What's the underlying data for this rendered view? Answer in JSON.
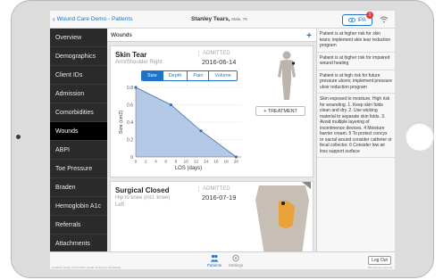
{
  "header": {
    "back_label": "Wound Care Demo - Patients",
    "patient_name": "Stanley Tears",
    "patient_meta": "Male, 79",
    "ipa_label": "IPA",
    "notification_count": "1"
  },
  "sidebar": {
    "items": [
      {
        "label": "Overview"
      },
      {
        "label": "Demographics"
      },
      {
        "label": "Client IDs"
      },
      {
        "label": "Admission"
      },
      {
        "label": "Comorbidities"
      },
      {
        "label": "Wounds"
      },
      {
        "label": "ABPI"
      },
      {
        "label": "Toe Pressure"
      },
      {
        "label": "Braden"
      },
      {
        "label": "Hemoglobin A1c"
      },
      {
        "label": "Referrals"
      },
      {
        "label": "Attachments"
      }
    ],
    "active": "Wounds"
  },
  "content": {
    "title": "Wounds",
    "add_label": "+"
  },
  "wounds": [
    {
      "title": "Skin Tear",
      "location_line1": "Arm/Shoulder Right",
      "admitted_label": "ADMITTED",
      "admitted_date": "2016-06-14",
      "tabs": [
        "Size",
        "Depth",
        "Pain",
        "Volume"
      ],
      "selected_tab": "Size",
      "treatment_label": "+ TREATMENT"
    },
    {
      "title": "Surgical Closed",
      "location_line1": "Hip to knee (incl. knee)",
      "location_line2": "Left",
      "admitted_label": "ADMITTED",
      "admitted_date": "2016-07-19"
    }
  ],
  "chart_data": {
    "type": "area",
    "x": [
      0,
      7,
      13,
      20
    ],
    "y": [
      0.8,
      0.6,
      0.3,
      0.0
    ],
    "xlabel": "LOS (days)",
    "ylabel": "Size (cm2)",
    "xlim": [
      0,
      21
    ],
    "ylim": [
      0,
      0.8
    ],
    "xticks": [
      "0",
      "2",
      "4",
      "6",
      "8",
      "10",
      "12",
      "14",
      "16",
      "18",
      "20"
    ],
    "yticks": [
      "0",
      "0.2",
      "0.4",
      "0.6",
      "0.8"
    ],
    "fill_color": "#b3c9e6",
    "line_color": "#3f6fb0"
  },
  "alerts": [
    "Patient is at higher risk for skin tears; implement skin tear reduction program",
    "Patient is at higher risk for impaired wound healing",
    "Patient is at high risk for future pressure ulcers; implement pressure ulcer reduction program",
    "Skin exposed to moisture. High risk for wounding. 1. Keep skin folds clean and dry. 2. Use wicking material to separate skin folds. 3. Avoid multiple layering of incontinence devices. 4 Moisture barrier cream. 5 To protect concyx or sacral wound consider catheter or fecal collector. 6 Consider low air loss support surface"
  ],
  "bottom": {
    "tab_patients": "Patients",
    "tab_settings": "Settings",
    "logout_label": "Log Out",
    "copyright": "HealPlat mobile ©2014-2017 Health Outcomes Worldwide",
    "version": "iPhones are sync ed"
  },
  "colors": {
    "accent": "#1e73c8",
    "sidebar_bg": "#2b2b2b",
    "badge": "#e53935"
  }
}
